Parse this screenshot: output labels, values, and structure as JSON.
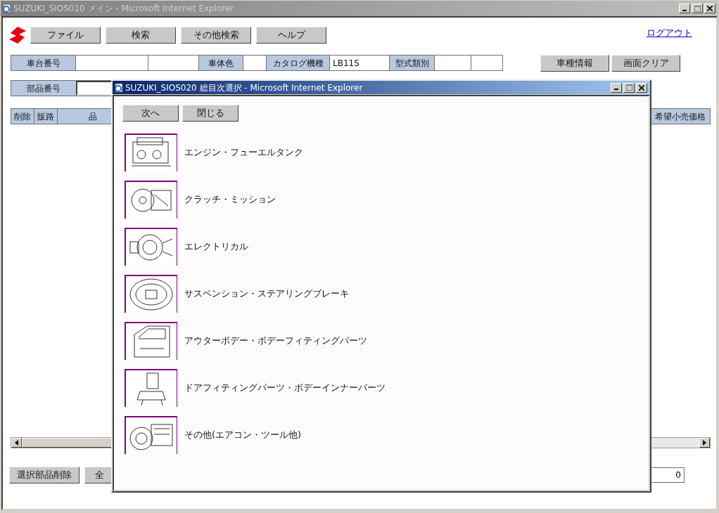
{
  "window": {
    "title": "SUZUKI_SIOS010 メイン - Microsoft Internet Explorer"
  },
  "menu_buttons": [
    "ファイル",
    "検索",
    "その他検索",
    "ヘルプ"
  ],
  "logout_link": "ログアウト",
  "vehicle_row": [
    {
      "kind": "label",
      "text": "車台番号"
    },
    {
      "kind": "empty"
    },
    {
      "kind": "empty"
    },
    {
      "kind": "label",
      "text": "車体色"
    },
    {
      "kind": "empty"
    },
    {
      "kind": "label",
      "text": "カタログ機種"
    },
    {
      "kind": "value",
      "text": "LB11S"
    },
    {
      "kind": "label",
      "text": "型式類別"
    },
    {
      "kind": "empty"
    },
    {
      "kind": "empty"
    }
  ],
  "vehicle_buttons": [
    "車種情報",
    "画面クリア"
  ],
  "part_number": {
    "label": "部品番号"
  },
  "table": {
    "columns": [
      "削除",
      "販路",
      "品"
    ],
    "last_column": "希望小売価格"
  },
  "bottom_buttons": [
    "選択部品削除",
    "全"
  ],
  "total_field": {
    "value": "0"
  },
  "dialog": {
    "title": "SUZUKI_SIOS020 総目次選択 - Microsoft Internet Explorer",
    "buttons": [
      "次へ",
      "閉じる"
    ],
    "categories": [
      {
        "label": "エンジン・フューエルタンク"
      },
      {
        "label": "クラッチ・ミッション"
      },
      {
        "label": "エレクトリカル"
      },
      {
        "label": "サスペンション・ステアリングブレーキ"
      },
      {
        "label": "アウターボデー・ボデーフィティングパーツ"
      },
      {
        "label": "ドアフィティングパーツ・ボデーインナーパーツ"
      },
      {
        "label": "その他(エアコン・ツール他)"
      }
    ]
  }
}
